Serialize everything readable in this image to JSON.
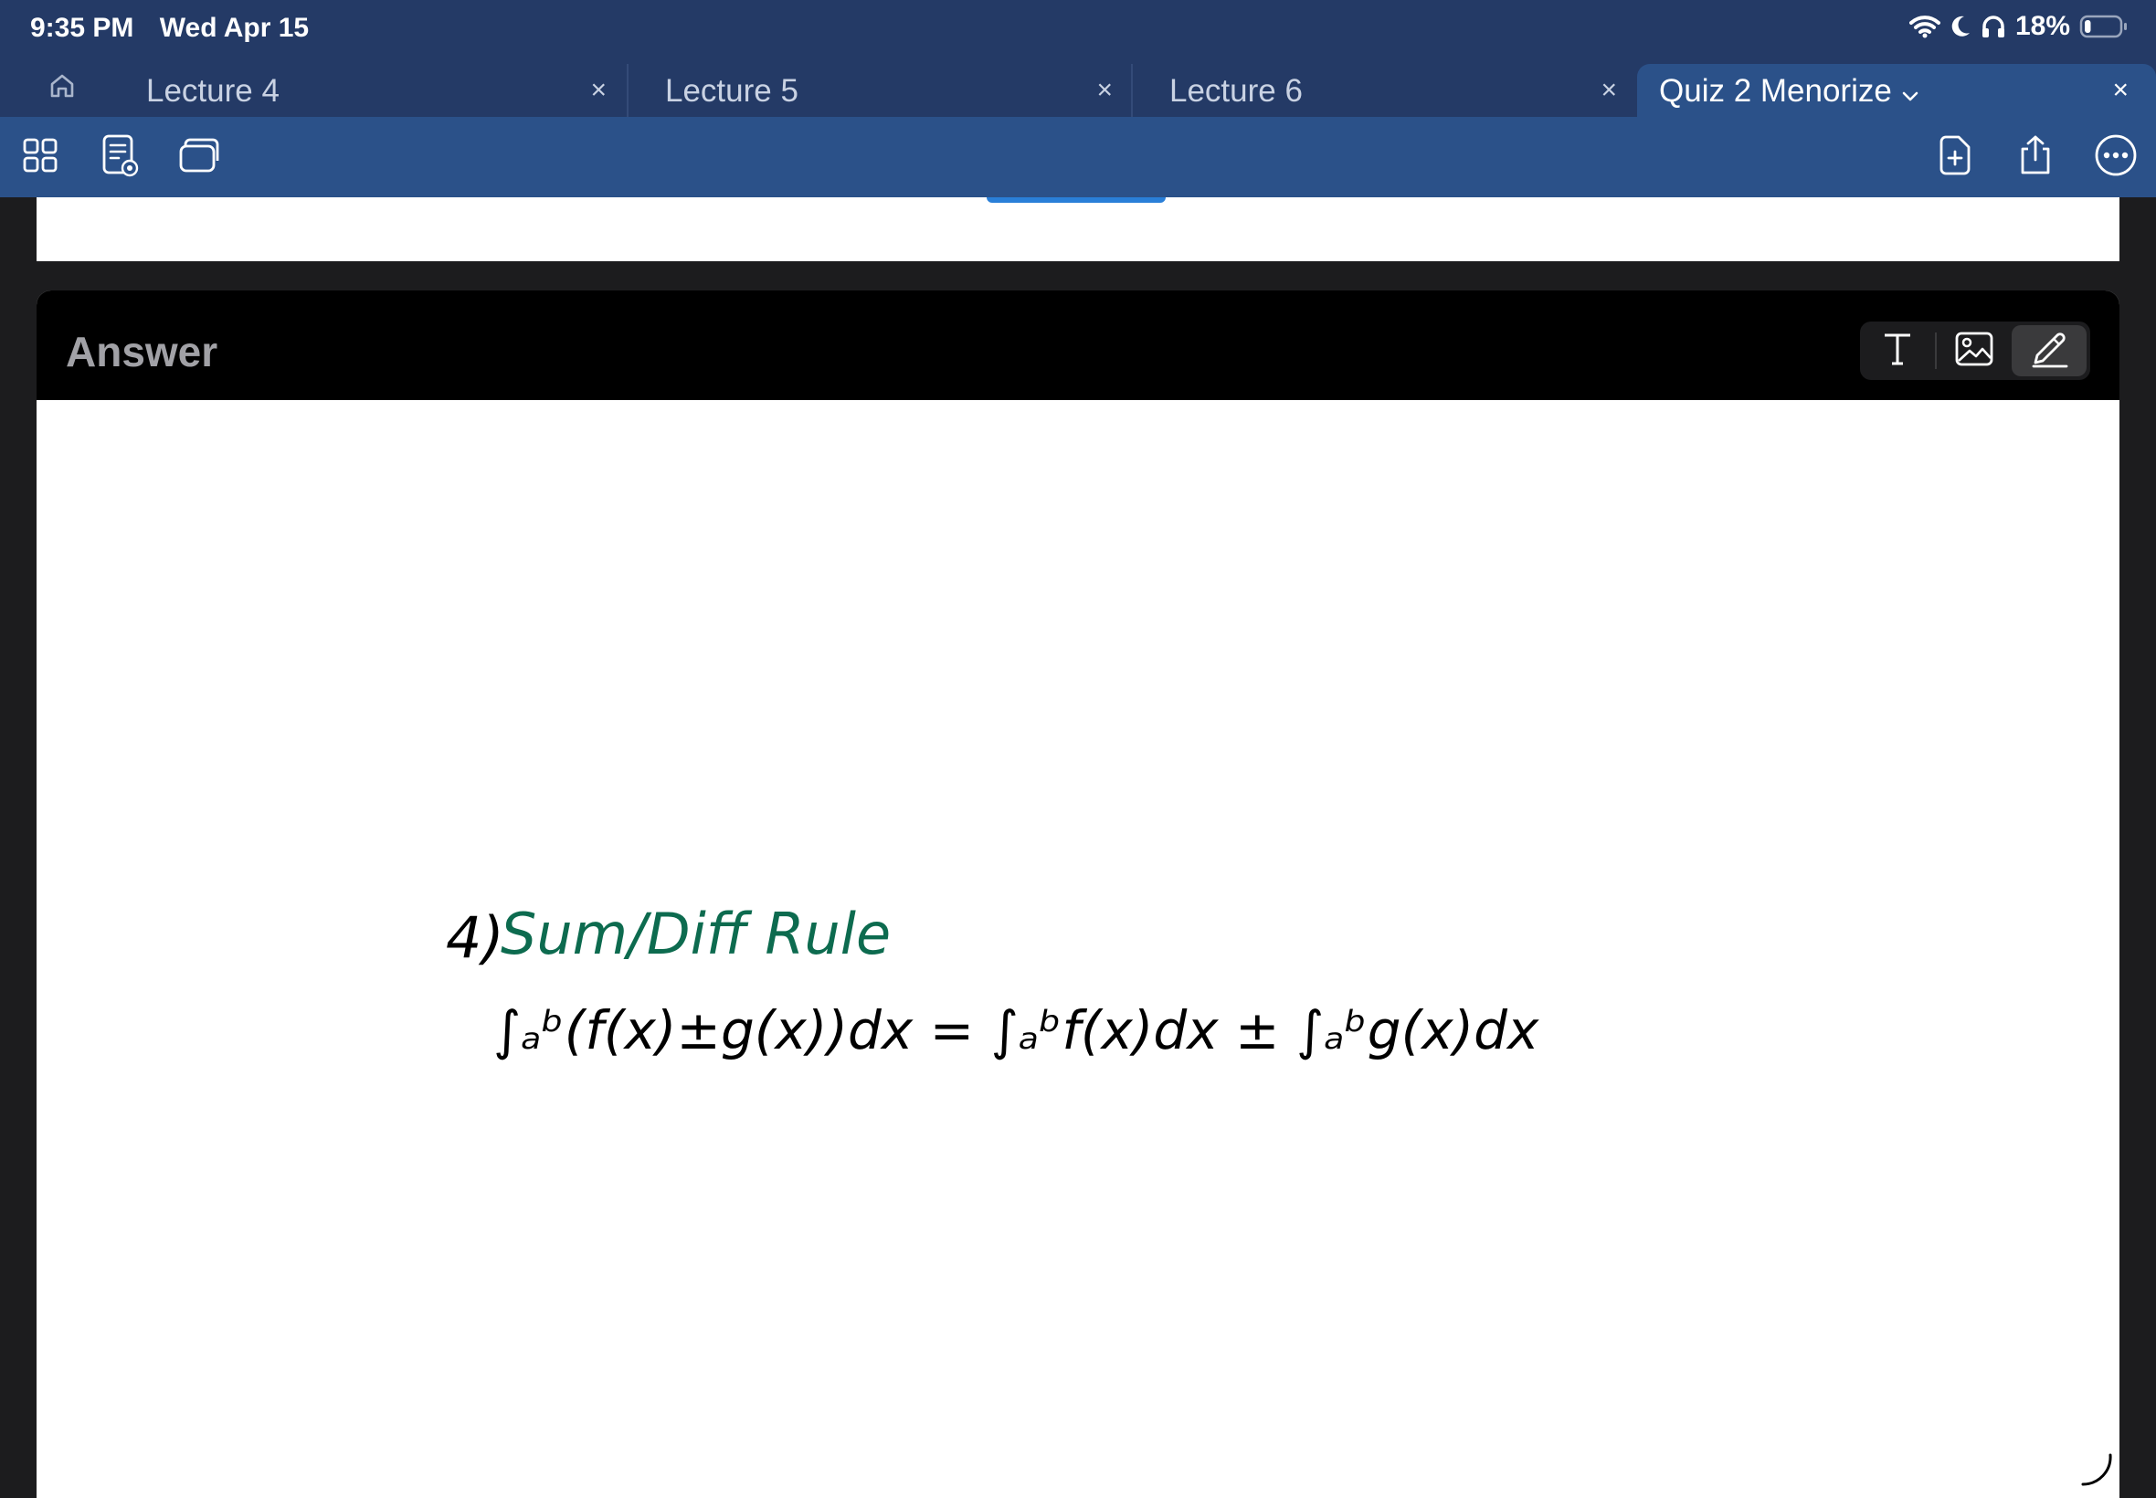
{
  "status_bar": {
    "time": "9:35 PM",
    "date": "Wed Apr 15",
    "battery_percent": "18%",
    "battery_level": 0.18,
    "icons": [
      "wifi-icon",
      "moon-icon",
      "headphones-icon",
      "battery-icon"
    ]
  },
  "tabs": [
    {
      "label": "Lecture 4",
      "active": false
    },
    {
      "label": "Lecture 5",
      "active": false
    },
    {
      "label": "Lecture 6",
      "active": false
    },
    {
      "label": "Quiz 2 Menorize",
      "active": true
    }
  ],
  "tab_close_glyph": "×",
  "toolbar": {
    "left_icons": [
      "grid-view-icon",
      "document-view-icon",
      "tabs-overview-icon"
    ],
    "right_icons": [
      "add-page-icon",
      "share-icon",
      "more-icon"
    ]
  },
  "answer": {
    "title": "Answer",
    "modes": [
      "text-mode-icon",
      "image-mode-icon",
      "pen-mode-icon"
    ],
    "selected_mode": "pen",
    "handwriting": {
      "number": "4)",
      "heading": "Sum/Diff Rule",
      "formula": "∫ₐᵇ(f(x)±g(x))dx = ∫ₐᵇf(x)dx ± ∫ₐᵇg(x)dx"
    }
  },
  "colors": {
    "status_bar_bg": "#243a66",
    "toolbar_bg": "#2b5189",
    "heading_ink": "#0d6b4f",
    "ink": "#000000",
    "page_indicator": "#2a7fd8"
  }
}
